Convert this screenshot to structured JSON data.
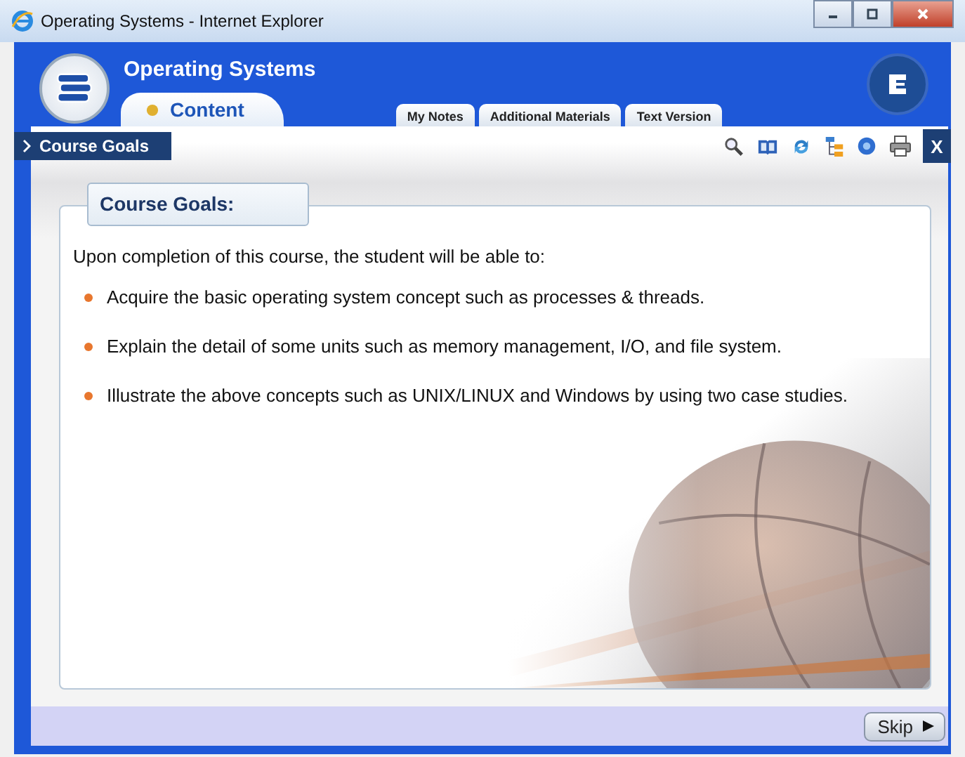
{
  "window": {
    "title": "Operating Systems - Internet Explorer"
  },
  "app": {
    "title": "Operating Systems"
  },
  "tabs": [
    {
      "label": "Content",
      "selected": true
    },
    {
      "label": "My Notes",
      "selected": false
    },
    {
      "label": "Additional Materials",
      "selected": false
    },
    {
      "label": "Text Version",
      "selected": false
    }
  ],
  "breadcrumb": "Course Goals",
  "close_label": "X",
  "section": {
    "heading": "Course Goals:",
    "intro": "Upon completion of this course, the student will be able to:",
    "bullets": [
      "Acquire the basic operating system concept such as processes & threads.",
      "Explain the detail of some units such as memory management, I/O, and file system.",
      "Illustrate the above concepts such as UNIX/LINUX and Windows by using two case studies."
    ]
  },
  "skip_label": "Skip"
}
